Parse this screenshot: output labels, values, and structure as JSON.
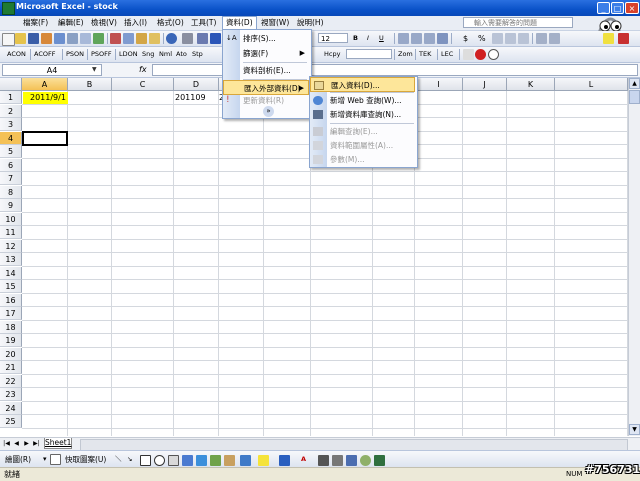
{
  "window": {
    "title": "Microsoft Excel - stock"
  },
  "menubar": {
    "items": [
      "檔案(F)",
      "編輯(E)",
      "檢視(V)",
      "插入(I)",
      "格式(O)",
      "工具(T)",
      "資料(D)",
      "視窗(W)",
      "說明(H)"
    ],
    "help_placeholder": "輸入需要解答的問題"
  },
  "toolbar1": {
    "font_size": "12",
    "currency": "$",
    "percent": "%"
  },
  "toolbar2": {
    "buttons": [
      "ACON",
      "ACOFF",
      "PSON",
      "PSOFF",
      "LDON",
      "Sng",
      "Nml",
      "Ato",
      "Stp"
    ],
    "right_buttons": [
      "Hcpy",
      "Zom",
      "TEK",
      "LEC"
    ]
  },
  "formula_bar": {
    "name_box": "A4",
    "fx": "fx",
    "formula": ""
  },
  "grid": {
    "columns": [
      "A",
      "B",
      "C",
      "D",
      "E",
      "F",
      "G",
      "H",
      "I",
      "J",
      "K",
      "L"
    ],
    "rows": [
      "1",
      "2",
      "3",
      "4",
      "5",
      "6",
      "7",
      "8",
      "9",
      "10",
      "11",
      "12",
      "13",
      "14",
      "15",
      "16",
      "17",
      "18",
      "19",
      "20",
      "21",
      "22",
      "23",
      "24",
      "25"
    ],
    "cells": {
      "A1": "2011/9/1",
      "D1": "201109",
      "E1": "2"
    }
  },
  "sheet_tabs": [
    "Sheet1"
  ],
  "data_menu": {
    "items": [
      "排序(S)...",
      "篩選(F)",
      "資料剖析(E)...",
      "匯入外部資料(D)",
      "更新資料(R)"
    ]
  },
  "import_submenu": {
    "items": [
      "匯入資料(D)...",
      "新增 Web 查詢(W)...",
      "新增資料庫查詢(N)...",
      "編輯查詢(E)...",
      "資料範圍屬性(A)...",
      "參數(M)..."
    ]
  },
  "drawing_toolbar": {
    "draw_label": "繪圖(R)",
    "autoshape_label": "快取圖案(U)"
  },
  "status_bar": {
    "status": "就緒",
    "num": "NUM"
  },
  "watermark": "#756731",
  "colors": {
    "selection_yellow": "#ffff00",
    "menu_highlight": "#fde69a",
    "title_blue": "#0a52c8"
  }
}
